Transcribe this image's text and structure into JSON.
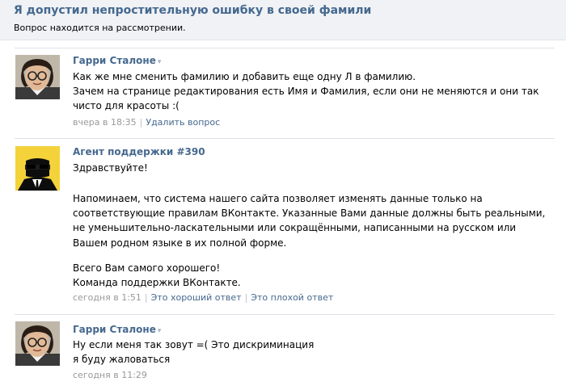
{
  "page": {
    "title": "Я допустил непростительную ошибку в своей фамили",
    "status": "Вопрос находится на рассмотрении."
  },
  "messages": [
    {
      "author": "Гарри Сталоне",
      "author_arrow": "▾",
      "lines": [
        "Как же мне сменить фамилию и добавить еще одну Л в фамилию.",
        "Зачем на странице редактирования есть Имя и Фамилия, если они не меняются и они так чисто для красоты :("
      ],
      "time": "вчера в 18:35",
      "action": "Удалить вопрос"
    },
    {
      "author": "Агент поддержки #390",
      "greeting": "Здравствуйте!",
      "body": "Напоминаем, что система нашего сайта позволяет изменять данные только на соответствующие правилам ВКонтакте. Указанные Вами данные должны быть реальными, не уменьшительно-ласкательными или сокращёнными, написанными на русском или Вашем родном языке в их полной форме.",
      "closing1": "Всего Вам самого хорошего!",
      "closing2": "Команда поддержки ВКонтакте.",
      "time": "сегодня в 1:51",
      "good": "Это хороший ответ",
      "bad": "Это плохой ответ"
    },
    {
      "author": "Гарри Сталоне",
      "author_arrow": "▾",
      "lines": [
        "Ну если меня так зовут =( Это дискриминация",
        "я буду жаловаться"
      ],
      "time": "сегодня в 11:29"
    }
  ],
  "colors": {
    "link": "#45688e",
    "header_bg": "#f0f2f5",
    "meta": "#999999"
  },
  "icons": {
    "user_avatar": "avatar-photo-icon",
    "agent_avatar": "support-agent-icon"
  }
}
